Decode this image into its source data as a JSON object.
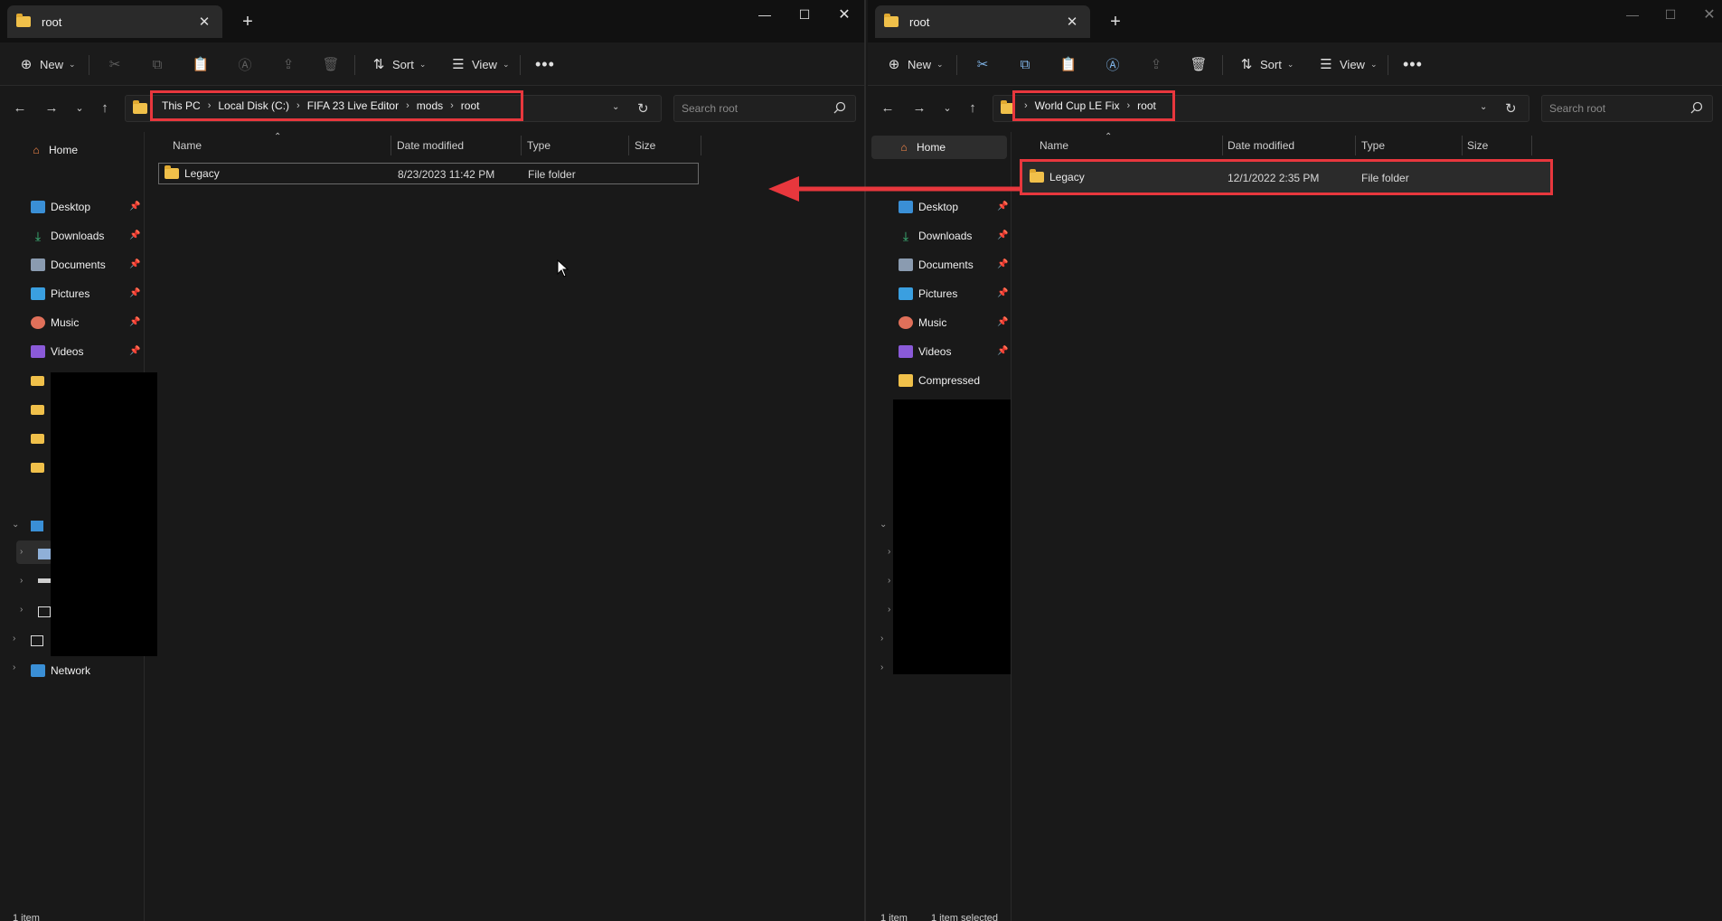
{
  "left": {
    "tab_title": "root",
    "toolbar": {
      "new_label": "New",
      "sort_label": "Sort",
      "view_label": "View"
    },
    "breadcrumb": [
      "This PC",
      "Local Disk (C:)",
      "FIFA 23 Live Editor",
      "mods",
      "root"
    ],
    "search_placeholder": "Search root",
    "sidebar": {
      "home": "Home",
      "items": [
        {
          "label": "Desktop",
          "icon": "desktop-icon"
        },
        {
          "label": "Downloads",
          "icon": "download-icon"
        },
        {
          "label": "Documents",
          "icon": "documents-icon"
        },
        {
          "label": "Pictures",
          "icon": "pictures-icon"
        },
        {
          "label": "Music",
          "icon": "music-icon"
        },
        {
          "label": "Videos",
          "icon": "videos-icon"
        }
      ],
      "network": "Network"
    },
    "columns": {
      "name": "Name",
      "date": "Date modified",
      "type": "Type",
      "size": "Size"
    },
    "rows": [
      {
        "name": "Legacy",
        "date": "8/23/2023 11:42 PM",
        "type": "File folder",
        "size": ""
      }
    ],
    "status": "1 item"
  },
  "right": {
    "tab_title": "root",
    "toolbar": {
      "new_label": "New",
      "sort_label": "Sort",
      "view_label": "View"
    },
    "breadcrumb": [
      "World Cup LE Fix",
      "root"
    ],
    "search_placeholder": "Search root",
    "sidebar": {
      "home": "Home",
      "items": [
        {
          "label": "Desktop",
          "icon": "desktop-icon"
        },
        {
          "label": "Downloads",
          "icon": "download-icon"
        },
        {
          "label": "Documents",
          "icon": "documents-icon"
        },
        {
          "label": "Pictures",
          "icon": "pictures-icon"
        },
        {
          "label": "Music",
          "icon": "music-icon"
        },
        {
          "label": "Videos",
          "icon": "videos-icon"
        }
      ],
      "compressed": "Compressed"
    },
    "columns": {
      "name": "Name",
      "date": "Date modified",
      "type": "Type",
      "size": "Size"
    },
    "rows": [
      {
        "name": "Legacy",
        "date": "12/1/2022 2:35 PM",
        "type": "File folder",
        "size": ""
      }
    ],
    "status": "1 item",
    "status_selected": "1 item selected"
  },
  "colors": {
    "highlight": "#e8373d",
    "folder": "#f0c04a",
    "background": "#191919"
  }
}
